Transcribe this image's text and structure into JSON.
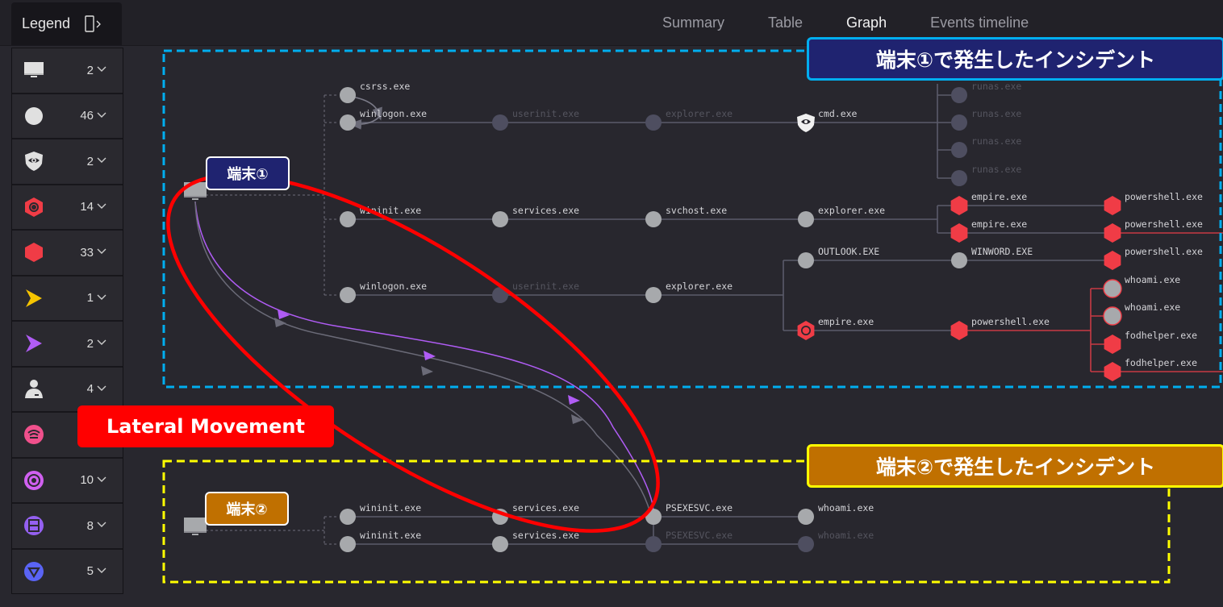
{
  "header": {
    "legend_title": "Legend",
    "tabs": [
      {
        "label": "Summary",
        "active": false
      },
      {
        "label": "Table",
        "active": false
      },
      {
        "label": "Graph",
        "active": true
      },
      {
        "label": "Events timeline",
        "active": false
      }
    ]
  },
  "legend": {
    "items": [
      {
        "icon": "computer-icon",
        "count": "2",
        "color": "#e0e0e0"
      },
      {
        "icon": "process-circle-icon",
        "count": "46",
        "color": "#e0e0e0"
      },
      {
        "icon": "eye-shield-icon",
        "count": "2",
        "color": "#e0e0e0"
      },
      {
        "icon": "hexagon-ring-icon",
        "count": "14",
        "color": "#f03c46"
      },
      {
        "icon": "hexagon-icon",
        "count": "33",
        "color": "#f03c46"
      },
      {
        "icon": "arrow-yellow-icon",
        "count": "1",
        "color": "#f5c400"
      },
      {
        "icon": "arrow-purple-icon",
        "count": "2",
        "color": "#b05cf5"
      },
      {
        "icon": "user-icon",
        "count": "4",
        "color": "#e0e0e0"
      },
      {
        "icon": "network-icon",
        "count": "",
        "color": "#f0508c"
      },
      {
        "icon": "target-icon",
        "count": "10",
        "color": "#d060f0"
      },
      {
        "icon": "registry-icon",
        "count": "8",
        "color": "#9460f0"
      },
      {
        "icon": "triangle-filter-icon",
        "count": "5",
        "color": "#5a64f5"
      }
    ]
  },
  "annotations": {
    "host1_badge": "端末①",
    "host2_badge": "端末②",
    "host1_incident": "端末①で発生したインシデント",
    "host2_incident": "端末②で発生したインシデント",
    "lateral_movement": "Lateral Movement"
  },
  "colors": {
    "host1_box": "#00aeef",
    "host2_box": "#ffff00",
    "host1_fill": "#1f2370",
    "host2_fill": "#c07000",
    "lateral_fill": "#ff0000",
    "malicious": "#f03c46",
    "process": "#a7a9ac",
    "inactive": "#4e4e60",
    "lateral_purple": "#b05cf5"
  },
  "graph": {
    "host1_nodes": [
      {
        "id": "csrss",
        "label": "csrss.exe",
        "kind": "process"
      },
      {
        "id": "winlogon1",
        "label": "winlogon.exe",
        "kind": "process"
      },
      {
        "id": "userinit1",
        "label": "userinit.exe",
        "kind": "inactive"
      },
      {
        "id": "explorer1",
        "label": "explorer.exe",
        "kind": "inactive"
      },
      {
        "id": "cmd",
        "label": "cmd.exe",
        "kind": "eye"
      },
      {
        "id": "runas1",
        "label": "runas.exe",
        "kind": "inactive"
      },
      {
        "id": "runas2",
        "label": "runas.exe",
        "kind": "inactive"
      },
      {
        "id": "runas3",
        "label": "runas.exe",
        "kind": "inactive"
      },
      {
        "id": "runas4",
        "label": "runas.exe",
        "kind": "inactive"
      },
      {
        "id": "wininit1",
        "label": "wininit.exe",
        "kind": "process"
      },
      {
        "id": "services1",
        "label": "services.exe",
        "kind": "process"
      },
      {
        "id": "svchost",
        "label": "svchost.exe",
        "kind": "process"
      },
      {
        "id": "explorer2",
        "label": "explorer.exe",
        "kind": "process"
      },
      {
        "id": "empire1",
        "label": "empire.exe",
        "kind": "hex"
      },
      {
        "id": "empire2",
        "label": "empire.exe",
        "kind": "hex"
      },
      {
        "id": "ps1",
        "label": "powershell.exe",
        "kind": "hex"
      },
      {
        "id": "ps2",
        "label": "powershell.exe",
        "kind": "hex"
      },
      {
        "id": "winlogon2",
        "label": "winlogon.exe",
        "kind": "process"
      },
      {
        "id": "userinit2",
        "label": "userinit.exe",
        "kind": "inactive"
      },
      {
        "id": "explorer3",
        "label": "explorer.exe",
        "kind": "process"
      },
      {
        "id": "outlook",
        "label": "OUTLOOK.EXE",
        "kind": "process"
      },
      {
        "id": "winword",
        "label": "WINWORD.EXE",
        "kind": "process"
      },
      {
        "id": "ps3",
        "label": "powershell.exe",
        "kind": "hex"
      },
      {
        "id": "empire3",
        "label": "empire.exe",
        "kind": "hexring"
      },
      {
        "id": "ps4",
        "label": "powershell.exe",
        "kind": "hex"
      },
      {
        "id": "whoami1",
        "label": "whoami.exe",
        "kind": "process-red"
      },
      {
        "id": "whoami2",
        "label": "whoami.exe",
        "kind": "process-red"
      },
      {
        "id": "fod1",
        "label": "fodhelper.exe",
        "kind": "hex"
      },
      {
        "id": "fod2",
        "label": "fodhelper.exe",
        "kind": "hex"
      }
    ],
    "host2_nodes": [
      {
        "id": "wininit2",
        "label": "wininit.exe",
        "kind": "process"
      },
      {
        "id": "services2",
        "label": "services.exe",
        "kind": "process"
      },
      {
        "id": "psexesvc1",
        "label": "PSEXESVC.exe",
        "kind": "process"
      },
      {
        "id": "whoami3",
        "label": "whoami.exe",
        "kind": "process"
      },
      {
        "id": "wininit3",
        "label": "wininit.exe",
        "kind": "process"
      },
      {
        "id": "services3",
        "label": "services.exe",
        "kind": "process"
      },
      {
        "id": "psexesvc2",
        "label": "PSEXESVC.exe",
        "kind": "inactive"
      },
      {
        "id": "whoami4",
        "label": "whoami.exe",
        "kind": "inactive"
      }
    ]
  }
}
